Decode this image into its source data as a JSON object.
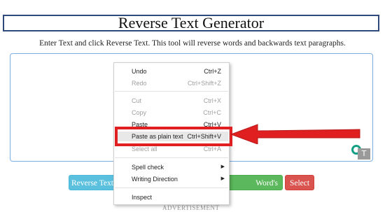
{
  "header": {
    "title": "Reverse Text Generator",
    "subtitle": "Enter Text and click Reverse Text. This tool will reverse words and backwards text paragraphs."
  },
  "editor": {
    "value": "",
    "placeholder": ""
  },
  "buttons": {
    "reverse_text": "Reverse Text",
    "words_lettering": "Word's Lettering",
    "select": "Select"
  },
  "advertisement": "ADVERTISEMENT",
  "context_menu": {
    "items": [
      {
        "label": "Undo",
        "shortcut": "Ctrl+Z",
        "enabled": true
      },
      {
        "label": "Redo",
        "shortcut": "Ctrl+Shift+Z",
        "enabled": false
      },
      {
        "label": "Cut",
        "shortcut": "Ctrl+X",
        "enabled": false
      },
      {
        "label": "Copy",
        "shortcut": "Ctrl+C",
        "enabled": false
      },
      {
        "label": "Paste",
        "shortcut": "Ctrl+V",
        "enabled": true
      },
      {
        "label": "Paste as plain text",
        "shortcut": "Ctrl+Shift+V",
        "enabled": true
      },
      {
        "label": "Select all",
        "shortcut": "Ctrl+A",
        "enabled": false
      },
      {
        "label": "Spell check",
        "shortcut": "",
        "enabled": true
      },
      {
        "label": "Writing Direction",
        "shortcut": "",
        "enabled": true
      },
      {
        "label": "Inspect",
        "shortcut": "",
        "enabled": true
      }
    ]
  },
  "icons": {
    "grammar_icon": "grammar-check-icon",
    "translate_icon": "translate-icon",
    "submenu_arrow": "chevron-right-icon"
  },
  "colors": {
    "title_border": "#2f4a7a",
    "textarea_border": "#7aaee6",
    "reverse_button": "#5bc0de",
    "lettering_button": "#5cb85c",
    "select_button": "#d9534f",
    "annotation_red": "#e02020"
  }
}
